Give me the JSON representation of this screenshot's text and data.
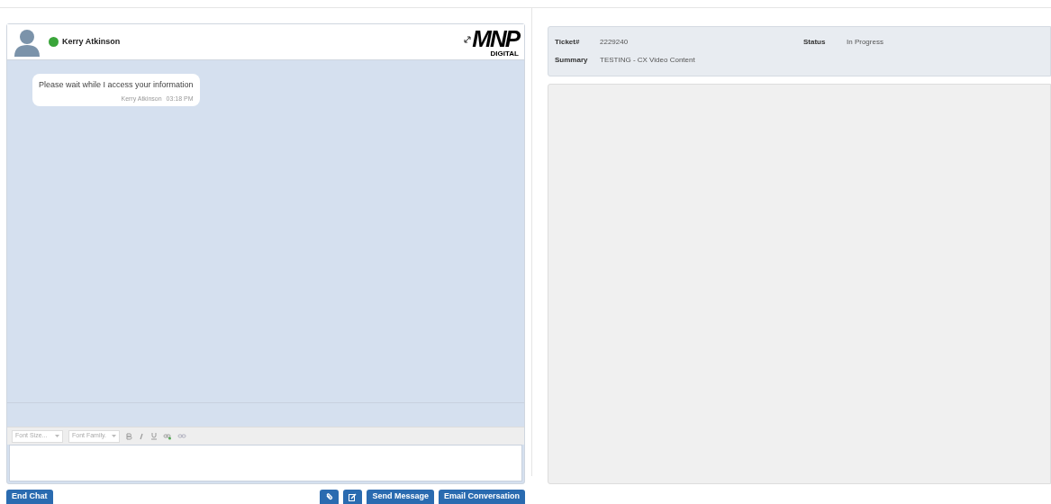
{
  "chat": {
    "agent": {
      "name": "Kerry Atkinson",
      "online": true
    },
    "logo": {
      "wordmark": "MNP",
      "subtitle": "DIGITAL"
    },
    "messages": [
      {
        "text": "Please wait while I access your information",
        "author": "Kerry Atkinson",
        "time": "03:18 PM"
      }
    ],
    "toolbar": {
      "font_size": {
        "placeholder": "Font Size..."
      },
      "font_family": {
        "placeholder": "Font Family."
      }
    },
    "buttons": [
      {
        "kind": "text",
        "label": "End Chat"
      },
      {
        "kind": "attach"
      },
      {
        "kind": "edit"
      },
      {
        "kind": "text",
        "label": "Send Message"
      },
      {
        "kind": "text",
        "label": "Email Conversation"
      }
    ]
  },
  "ticket": {
    "fields": [
      {
        "label": "Ticket#",
        "value": "2229240"
      },
      {
        "label": "Status",
        "value": "In Progress"
      },
      {
        "label": "Summary",
        "value": "TESTING - CX Video Content"
      }
    ]
  }
}
